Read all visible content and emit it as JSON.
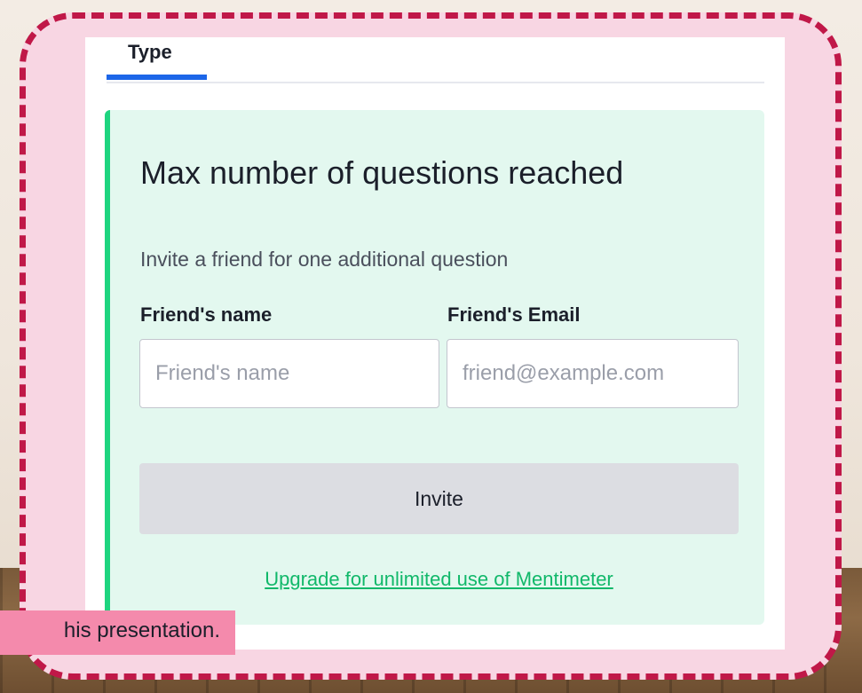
{
  "tabs": {
    "active_label": "Type"
  },
  "limit_card": {
    "title": "Max number of questions reached",
    "subtitle": "Invite a friend for one additional question",
    "name_label": "Friend's name",
    "name_placeholder": "Friend's name",
    "name_value": "",
    "email_label": "Friend's Email",
    "email_placeholder": "friend@example.com",
    "email_value": "",
    "invite_label": "Invite",
    "upgrade_link": "Upgrade for unlimited use of Mentimeter"
  },
  "toast": {
    "text": "his presentation."
  },
  "colors": {
    "frame_border": "#c01848",
    "frame_fill": "#f8d6e3",
    "tab_underline": "#1c66e8",
    "card_accent": "#1ed47f",
    "card_fill": "#e3f8ef",
    "link": "#11b86a",
    "toast_fill": "#f48aac"
  }
}
